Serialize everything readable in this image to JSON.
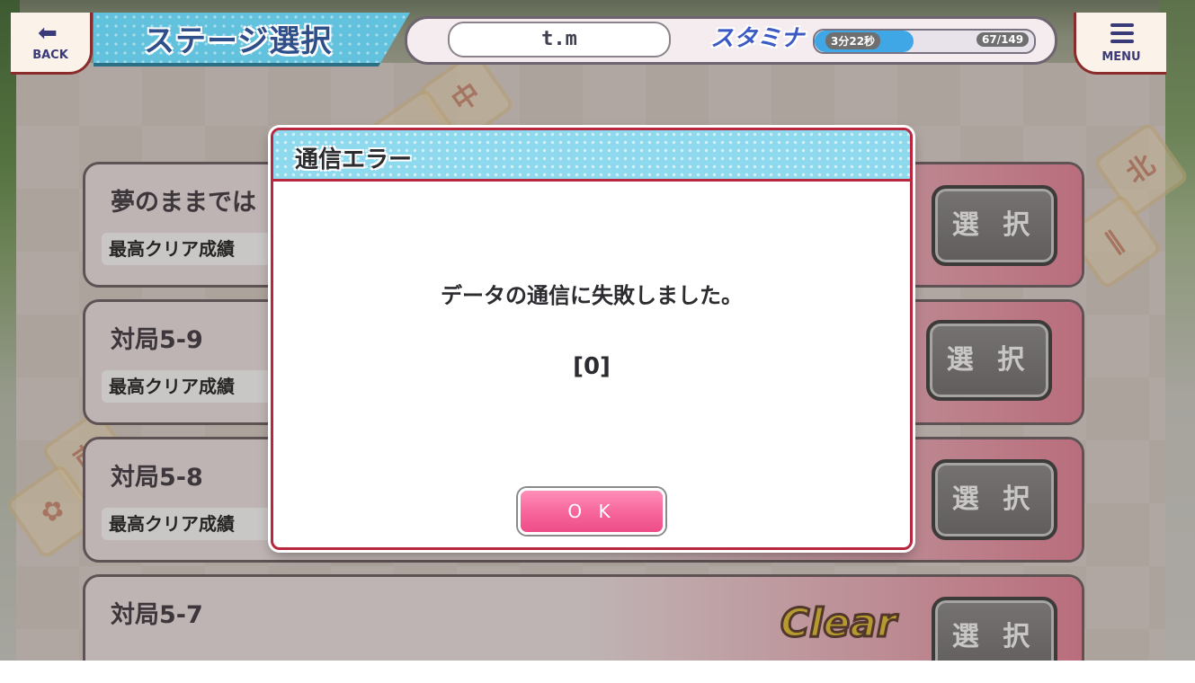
{
  "header": {
    "back_label": "BACK",
    "title": "ステージ選択",
    "player_name": "t.m",
    "stamina_label": "スタミナ",
    "stamina_timer": "3分22秒",
    "stamina_count": "67/149",
    "stamina_fraction": 0.45,
    "menu_label": "MENU"
  },
  "stages": [
    {
      "title": "夢のままでは",
      "record_label": "最高クリア成績",
      "select_label": "選 択"
    },
    {
      "title": "対局5-9",
      "record_label": "最高クリア成績",
      "select_label": "選 択"
    },
    {
      "title": "対局5-8",
      "record_label": "最高クリア成績",
      "select_label": "選 択"
    },
    {
      "title": "対局5-7",
      "record_label": "",
      "select_label": "選 択"
    }
  ],
  "clear_stamp": "Clear",
  "dialog": {
    "title": "通信エラー",
    "message": "データの通信に失敗しました。",
    "code": "[0]",
    "ok_label": "O K"
  },
  "colors": {
    "accent_pink": "#f6649a",
    "header_blue": "#62c1dc",
    "frame_red": "#b9273f"
  }
}
